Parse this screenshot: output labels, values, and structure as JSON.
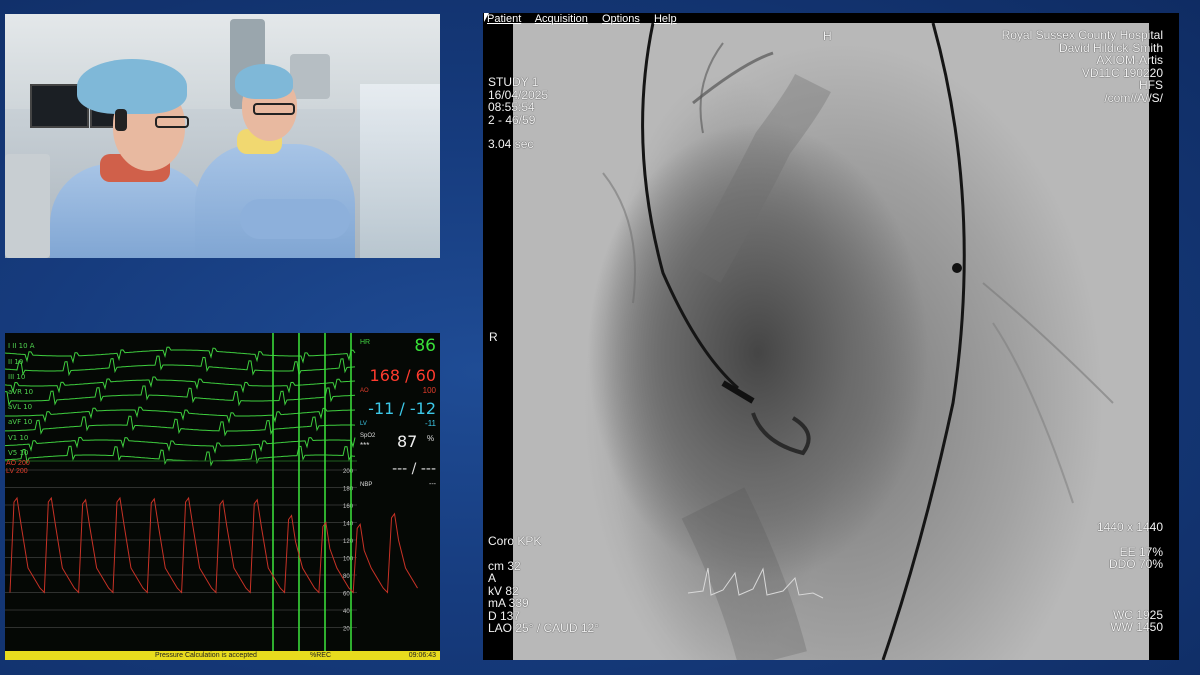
{
  "menu": {
    "patient": "Patient",
    "acquisition": "Acquisition",
    "options": "Options",
    "help": "Help"
  },
  "xray": {
    "orientation_top": "H",
    "orientation_left": "R",
    "study": "STUDY 1",
    "date": "16/04/2025",
    "time": "08:55:54",
    "frame": "2 - 46/59",
    "duration": "3.04 sec",
    "hospital": "Royal Sussex County Hospital",
    "operator": "David Hildick-Smith",
    "system": "AXIOM-Artis",
    "version": "VD11C 190220",
    "position": "HFS",
    "path": "/com//A//S/",
    "protocol": "Coro KPK",
    "cm": "cm 32",
    "a": "A",
    "kv": "kV 82",
    "ma": "mA 339",
    "d": "D 137",
    "angle": "LAO 25° / CAUD 12°",
    "matrix": "1440 x 1440",
    "ee": "EE 17%",
    "ddo": "DDO 70%",
    "wc": "WC 1925",
    "ww": "WW 1450"
  },
  "monitor": {
    "leads": [
      "I II 10  A",
      "II 10",
      "III 10",
      "aVR 10",
      "aVL 10",
      "aVF 10",
      "V1 10",
      "V5 10"
    ],
    "ao_scale": "AO 200",
    "lv_scale": "LV 200",
    "hr_label": "HR",
    "hr": "86",
    "bp": "168 / 60",
    "ao_label": "AO",
    "ao_mean": "100",
    "lv_pressure": "-11 / -12",
    "lv_label": "LV",
    "lv_mean": "-11",
    "spo2_label": "SpO2",
    "spo2_stars": "***",
    "spo2": "87",
    "spo2_unit": "%",
    "nbp_value": "--- / ---",
    "nbp_label": "NBP",
    "nbp_mean": "---",
    "scale_values": [
      "200",
      "180",
      "160",
      "140",
      "120",
      "100",
      "80",
      "60",
      "40",
      "20"
    ],
    "status_message": "Pressure Calculation is accepted",
    "rec": "%REC",
    "clock": "09:06:43"
  },
  "colors": {
    "ecg": "#3fcf3f",
    "pressure": "#c83226",
    "hr": "#38e038",
    "bp": "#ff3b2e",
    "lv": "#3cc8e8",
    "status_bar": "#e8dc1e",
    "background": "#1a4385"
  },
  "pressure_peaks": [
    168,
    168,
    166,
    168,
    167,
    168,
    165,
    166,
    148,
    140,
    138,
    150
  ]
}
